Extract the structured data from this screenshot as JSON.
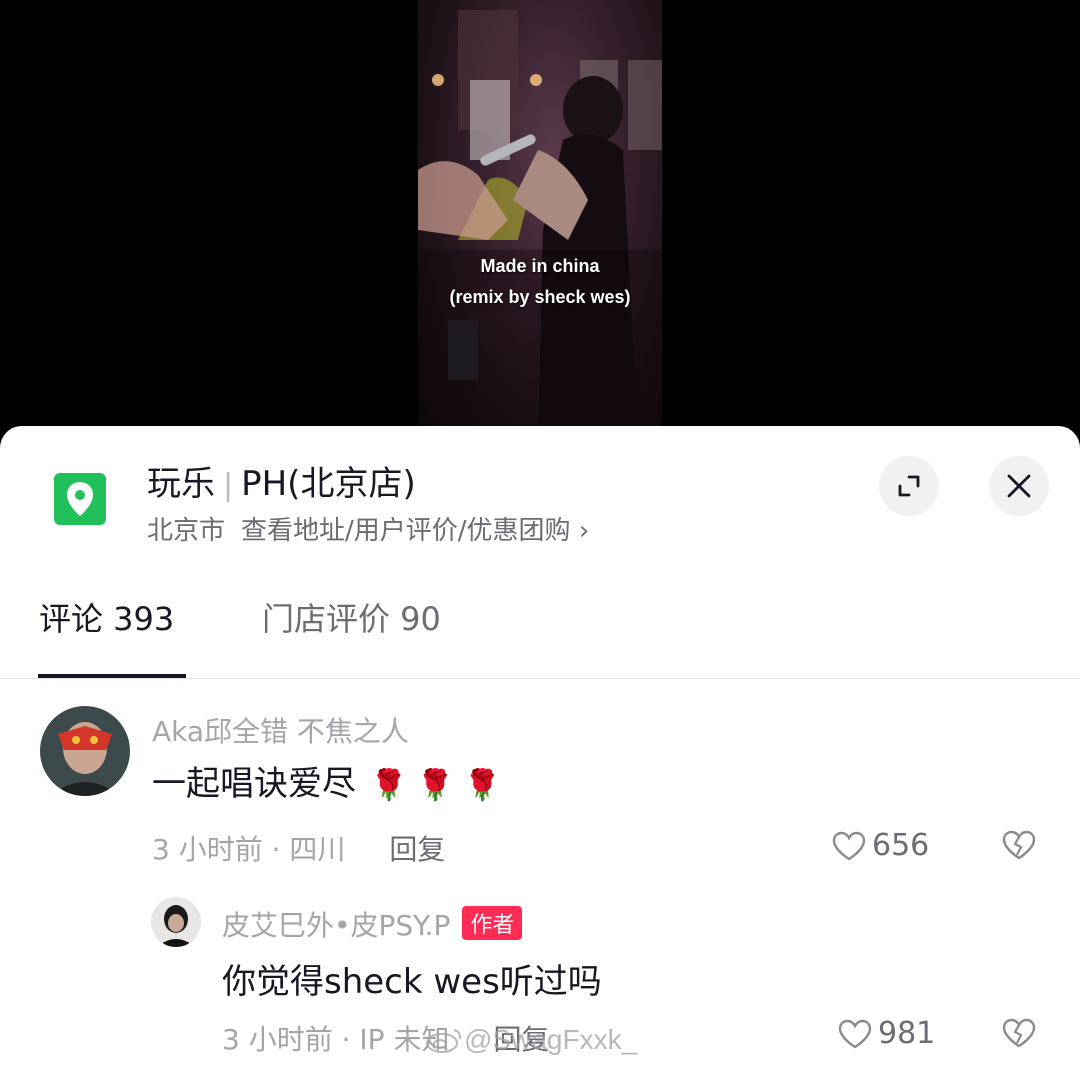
{
  "video": {
    "caption_line1": "Made in china",
    "caption_line2": "(remix by sheck wes)"
  },
  "location": {
    "icon": "map-pin-icon",
    "category": "玩乐",
    "name": "PH(北京店)",
    "city": "北京市",
    "details_link": "查看地址/用户评价/优惠团购",
    "chevron": "›",
    "accent_color": "#22c05a"
  },
  "tabs": [
    {
      "label": "评论 393"
    },
    {
      "label": "门店评价 90"
    }
  ],
  "comments": [
    {
      "username": "Aka邱全错 不焦之人",
      "text": "一起唱诀爱尽",
      "emoji": "🌹 🌹 🌹",
      "time_location": "3 小时前 · 四川",
      "reply_label": "回复",
      "likes": "656"
    },
    {
      "username": "皮艾巳外•皮PSY.P",
      "badge": "作者",
      "text": "你觉得sheck wes听过吗",
      "time_location": "3 小时前 · IP 未知",
      "reply_label": "回复",
      "likes": "981"
    }
  ],
  "watermark": "@SwagFxxk_",
  "colors": {
    "badge": "#fe2c55",
    "text_primary": "#161823",
    "text_secondary": "#a4a5ab"
  }
}
